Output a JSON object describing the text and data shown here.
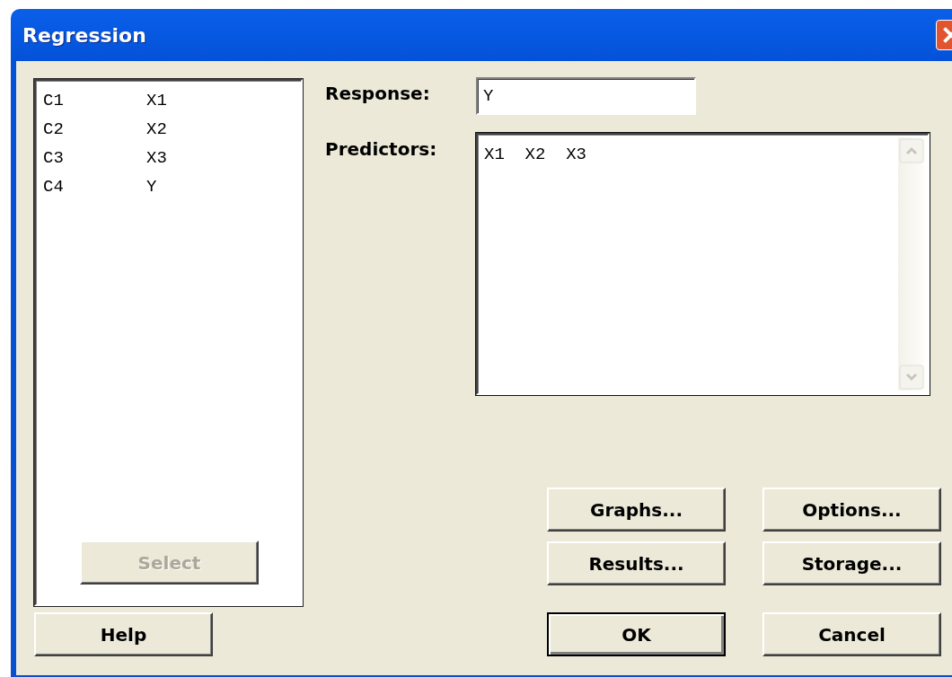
{
  "window": {
    "title": "Regression"
  },
  "variables": {
    "items": [
      {
        "column": "C1",
        "name": "X1"
      },
      {
        "column": "C2",
        "name": "X2"
      },
      {
        "column": "C3",
        "name": "X3"
      },
      {
        "column": "C4",
        "name": "Y"
      }
    ],
    "select_button": {
      "label": "Select",
      "disabled": true
    }
  },
  "help_button": {
    "label": "Help"
  },
  "response": {
    "label": "Response:",
    "value": "Y"
  },
  "predictors": {
    "label": "Predictors:",
    "value": "X1  X2  X3"
  },
  "buttons": [
    {
      "label": "Graphs...",
      "default": false
    },
    {
      "label": "Options...",
      "default": false
    },
    {
      "label": "Results...",
      "default": false
    },
    {
      "label": "Storage...",
      "default": false
    },
    {
      "label": "OK",
      "default": true
    },
    {
      "label": "Cancel",
      "default": false
    }
  ]
}
